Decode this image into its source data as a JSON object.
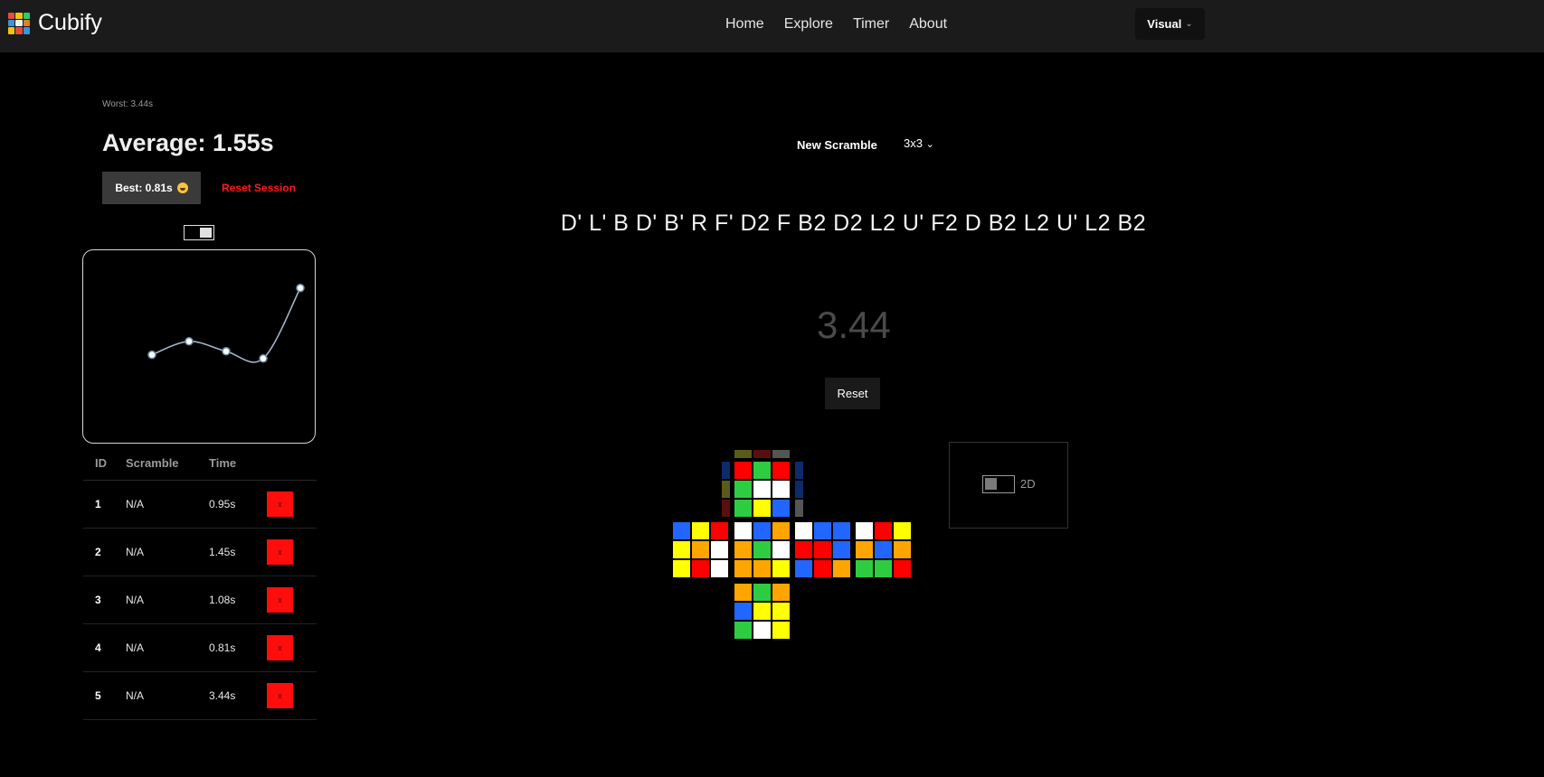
{
  "nav": {
    "brand": "Cubify",
    "links": [
      "Home",
      "Explore",
      "Timer",
      "About"
    ],
    "visual_label": "Visual"
  },
  "session": {
    "worst": "Worst: 3.44s",
    "average": "Average: 1.55s",
    "best": "Best: 0.81s",
    "reset_label": "Reset Session"
  },
  "chart_data": {
    "type": "line",
    "x": [
      1,
      2,
      3,
      4,
      5
    ],
    "values": [
      0.95,
      1.45,
      1.08,
      0.81,
      3.44
    ],
    "ylim": [
      0.5,
      3.6
    ],
    "grid": false,
    "line_color": "#9fb3c8"
  },
  "table": {
    "headers": [
      "ID",
      "Scramble",
      "Time"
    ],
    "rows": [
      {
        "id": "1",
        "scramble": "N/A",
        "time": "0.95s"
      },
      {
        "id": "2",
        "scramble": "N/A",
        "time": "1.45s"
      },
      {
        "id": "3",
        "scramble": "N/A",
        "time": "1.08s"
      },
      {
        "id": "4",
        "scramble": "N/A",
        "time": "0.81s"
      },
      {
        "id": "5",
        "scramble": "N/A",
        "time": "3.44s"
      }
    ],
    "delete_label": "x"
  },
  "timer_panel": {
    "new_scramble_label": "New Scramble",
    "cube_type": "3x3",
    "scramble": "D' L' B D' B' R F' D2 F B2 D2 L2 U' F2 D B2 L2 U' L2 B2",
    "time": "3.44",
    "reset_label": "Reset"
  },
  "view_toggle": {
    "label": "2D"
  },
  "colors": {
    "R": "#ff0000",
    "G": "#2ecc40",
    "W": "#ffffff",
    "Y": "#ffff00",
    "B": "#2166ff",
    "O": "#ffa500"
  },
  "cube": {
    "U": [
      "RGR",
      "GWW",
      "GYB"
    ],
    "L": [
      "BYR",
      "YOW",
      "YRW"
    ],
    "F": [
      "WBO",
      "OGW",
      "OOY"
    ],
    "R": [
      "WBB",
      "RRB",
      "BRO"
    ],
    "Bk": [
      "WRY",
      "OBO",
      "GGR"
    ],
    "D": [
      "OGO",
      "BYY",
      "GWY"
    ]
  }
}
